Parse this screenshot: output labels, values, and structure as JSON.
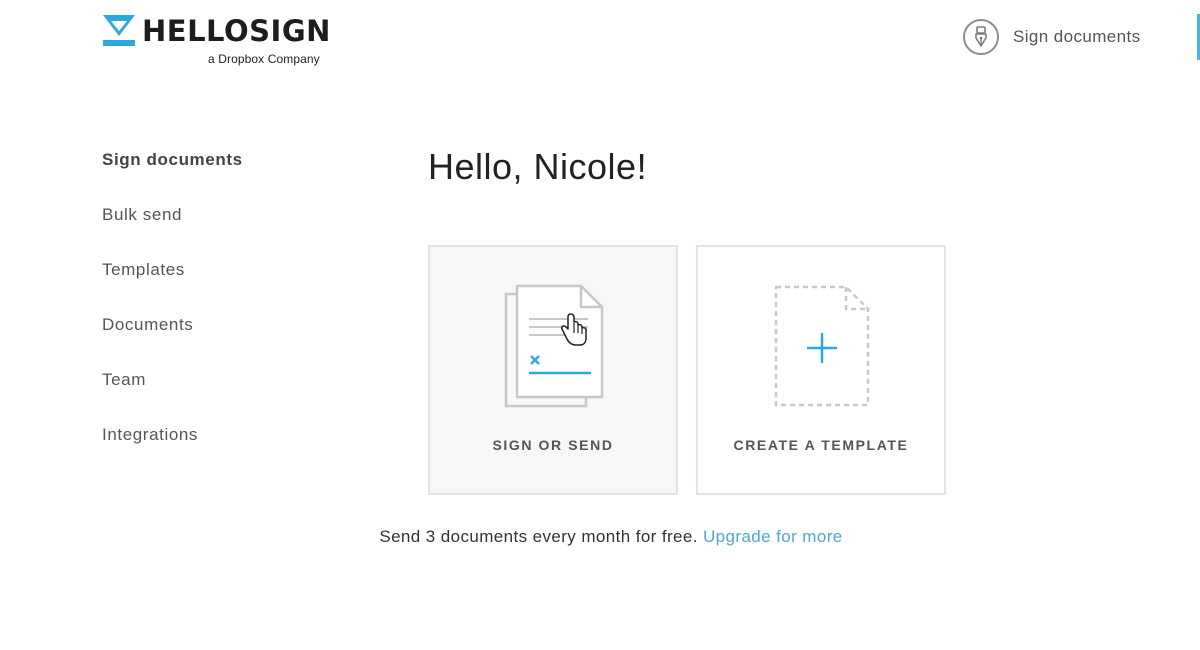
{
  "brand": {
    "name": "HELLOSIGN",
    "tagline": "a Dropbox Company",
    "accent_color": "#2ba8de"
  },
  "header": {
    "action_icon": "pen-nib-icon",
    "action_label": "Sign documents"
  },
  "sidebar": {
    "items": [
      {
        "label": "Sign documents",
        "active": true
      },
      {
        "label": "Bulk send"
      },
      {
        "label": "Templates"
      },
      {
        "label": "Documents"
      },
      {
        "label": "Team"
      },
      {
        "label": "Integrations"
      }
    ]
  },
  "main": {
    "greeting": "Hello, Nicole!",
    "cards": [
      {
        "label": "SIGN OR SEND",
        "icon": "sign-document-icon"
      },
      {
        "label": "CREATE A TEMPLATE",
        "icon": "add-template-icon"
      }
    ],
    "footer": {
      "text": "Send 3 documents every month for free.",
      "link": "Upgrade for more",
      "link_color": "#4fa8d3"
    }
  }
}
